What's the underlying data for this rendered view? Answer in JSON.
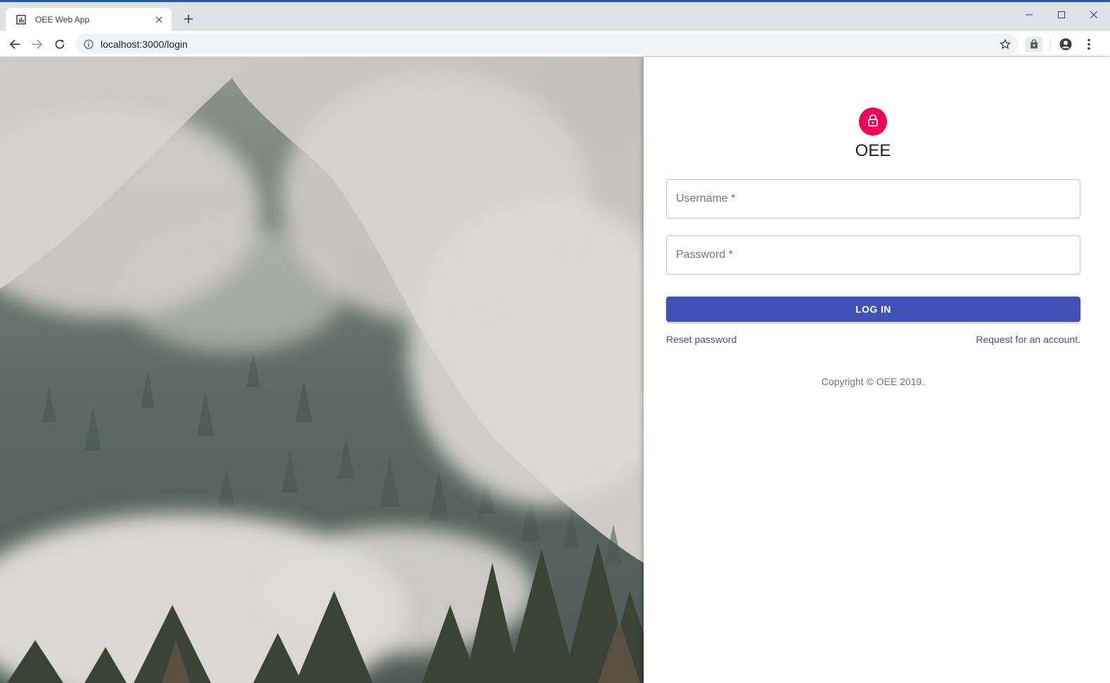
{
  "browser": {
    "tab": {
      "title": "OEE Web App",
      "favicon": "chart-favicon-icon"
    },
    "address_bar": {
      "url": "localhost:3000/login"
    },
    "icons": [
      "back-arrow-icon",
      "forward-arrow-icon",
      "reload-icon",
      "info-icon",
      "star-icon",
      "extension-icon",
      "profile-icon",
      "more-vert-icon",
      "minimize-icon",
      "maximize-icon",
      "close-icon",
      "plus-icon"
    ]
  },
  "login": {
    "avatar_icon": "lock-icon",
    "title": "OEE",
    "username_label": "Username *",
    "password_label": "Password *",
    "submit_label": "LOG IN",
    "reset_link": "Reset password",
    "request_link": "Request for an account.",
    "copyright": "Copyright © OEE 2019."
  },
  "colors": {
    "primary": "#3f51b5",
    "accent": "#f50057",
    "chrome_tabstrip": "#dee1e6"
  }
}
